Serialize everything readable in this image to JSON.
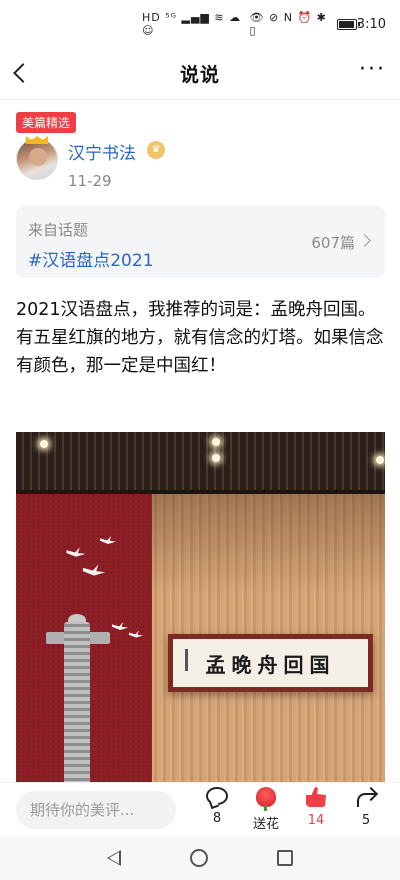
{
  "status_bar": {
    "left_glyphs": "HD ⁵ᴳ ▂▄▆ ≋ ☁ ☺",
    "right_glyphs": "👁 ⊘ N ⏰ ✱ ▯",
    "battery_level": 0.85,
    "time": "3:10"
  },
  "header": {
    "title": "说说",
    "more": "···"
  },
  "post": {
    "badge": "美篇精选",
    "author": "汉宁书法",
    "date": "11-29",
    "topic": {
      "from_label": "来自话题",
      "name": "#汉语盘点2021",
      "count": "607篇"
    },
    "text_lines": [
      "2021汉语盘点，我推荐的词是：孟晚舟回国。",
      "有五星红旗的地方，就有信念的灯塔。如果信念有颜色，那一定是中国红！"
    ],
    "image": {
      "calligraphy": "孟晚舟回国"
    }
  },
  "actions": {
    "comment_placeholder": "期待你的美评...",
    "comments_count": "8",
    "flower_label": "送花",
    "likes_count": "14",
    "shares_count": "5"
  }
}
